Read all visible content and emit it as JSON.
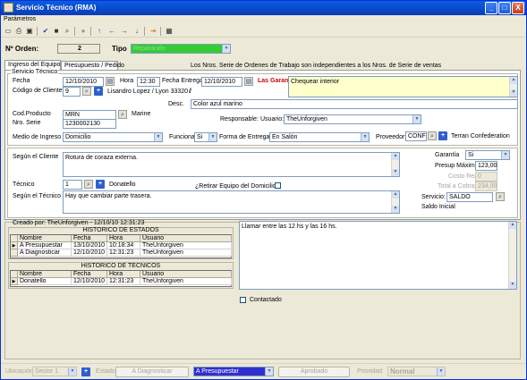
{
  "window": {
    "title": "Servicio Técnico (RMA)",
    "min": "_",
    "max": "□",
    "close": "X"
  },
  "menu": {
    "parametros": "Parámetros"
  },
  "header": {
    "orden_label": "Nº Orden:",
    "orden_value": "2",
    "tipo_label": "Tipo",
    "tipo_value": "Reparación"
  },
  "tabs": [
    {
      "label": "Ingreso del Equipo"
    },
    {
      "label": "Presupuesto / Pedido"
    }
  ],
  "info_note": "Los Nros. Serie de Ordenes de Trabajo son independientes a los Nros. de Serie de ventas",
  "servicio": {
    "section_label": "Servicio Técnico",
    "fecha_label": "Fecha",
    "fecha_value": "12/10/2010",
    "hora_label": "Hora",
    "hora_value": "12:30",
    "fecha_entrega_label": "Fecha Entrega",
    "fecha_entrega_value": "12/10/2010",
    "las_garantias": "Las Garan",
    "chequear": "Chequear interior",
    "codigo_cliente_label": "Código de Cliente",
    "codigo_cliente_value": "9",
    "cliente_nombre": "Lisandro Lopez / Lyon 33320 /",
    "slash": "/",
    "desc_label": "Desc.",
    "desc_value": "Color azul marino",
    "cod_producto_label": "Cod.Producto",
    "cod_producto_value": "MRN",
    "producto_nombre": "Marine",
    "nro_serie_label": "Nro. Serie",
    "nro_serie_value": "1230002130",
    "responsable_label": "Responsable:",
    "usuario_label": "Usuario:",
    "usuario_value": "TheUnforgiven",
    "medio_label": "Medio de Ingreso",
    "medio_value": "Domicilio",
    "funciona_label": "Funciona",
    "funciona_value": "Si",
    "forma_entrega_label": "Forma de Entrega",
    "forma_entrega_value": "En Salón",
    "proveedor_label": "Proveedor:",
    "proveedor_value": "CONF",
    "proveedor_nombre": "Terran Confederation"
  },
  "detalle": {
    "segun_cliente_label": "Según el Cliente",
    "segun_cliente_value": "Rotura de coraza externa.",
    "tecnico_label": "Técnico",
    "tecnico_value": "1",
    "tecnico_nombre": "Donatello",
    "retirar_label": "¿Retirar Equipo del Domicilio?",
    "segun_tecnico_label": "Según el Técnico",
    "segun_tecnico_value": "Hay que cambiar parte trasera.",
    "garantia_label": "Garantía",
    "garantia_value": "Si",
    "presup_max_label": "Presup Máximo",
    "presup_max_value": "123,00",
    "costo_real_label": "Costo Real",
    "costo_real_value": "0",
    "total_cobrar_label": "Total a Cobrar",
    "total_cobrar_value": "234,00",
    "servicio_label": "Servicio:",
    "servicio_value": "SALDO",
    "saldo_inicial_label": "Saldo Inicial"
  },
  "historial": {
    "creado_por": "Creado por: TheUnforgiven - 12/10/10 12:31:23",
    "estados_title": "HISTORICO DE ESTADOS",
    "estados_cols": [
      "Nombre",
      "Fecha",
      "Hora",
      "Usuario"
    ],
    "estados_rows": [
      [
        "A Presupuestar",
        "13/10/2010",
        "10:18:34",
        "TheUnforgiven"
      ],
      [
        "A Diagnosticar",
        "12/10/2010",
        "12:31:23",
        "TheUnforgiven"
      ]
    ],
    "tecnicos_title": "HISTORICO DE TECNICOS",
    "tecnicos_cols": [
      "Nombre",
      "Fecha",
      "Hora",
      "Usuario"
    ],
    "tecnicos_rows": [
      [
        "Donatello",
        "12/10/2010",
        "12:31:23",
        "TheUnforgiven"
      ]
    ]
  },
  "notas": {
    "value": "Llamar entre las 12 hs y las 16 hs.",
    "contactado_label": "Contactado"
  },
  "footer": {
    "ubicacion_label": "Ubicación",
    "ubicacion_value": "Sector 1",
    "estado_label": "Estado",
    "btn_diagnosticar": "A Diagnosticar",
    "estado_value": "A Presupuestar",
    "btn_aprobado": "Aprobado",
    "prioridad_label": "Prioridad",
    "prioridad_value": "Normal"
  },
  "colors": {
    "title_bar": "#0b47c9",
    "tipo_bg": "#33cc33",
    "estado_bg": "#3030d0",
    "warning_red": "#d00000",
    "note_bg": "#ffffcc"
  }
}
